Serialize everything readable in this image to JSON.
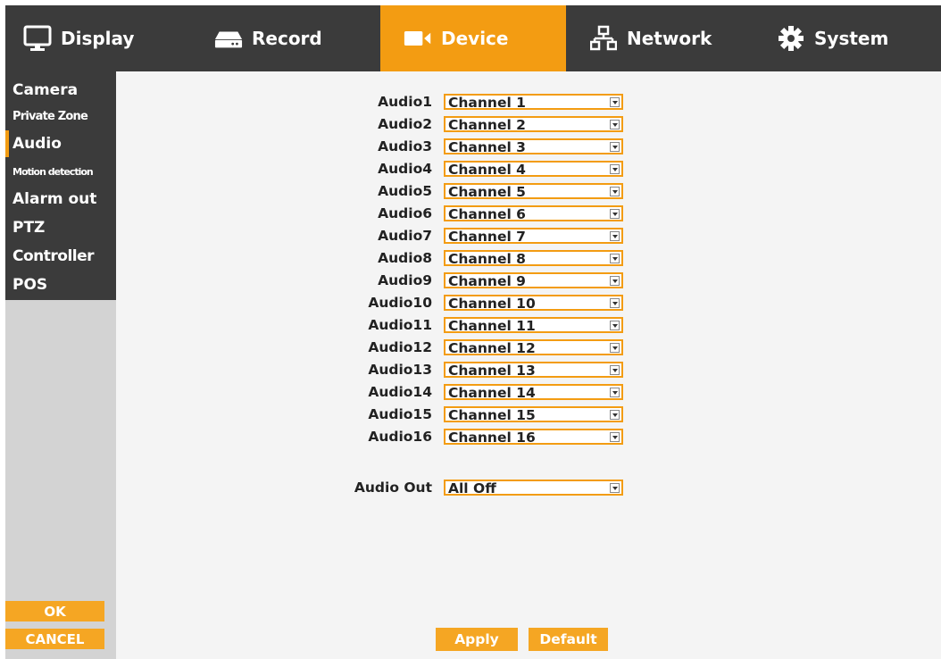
{
  "nav": {
    "tabs": [
      {
        "label": "Display"
      },
      {
        "label": "Record"
      },
      {
        "label": "Device"
      },
      {
        "label": "Network"
      },
      {
        "label": "System"
      }
    ],
    "active_tab": "Device"
  },
  "sidebar": {
    "items": [
      {
        "label": "Camera"
      },
      {
        "label": "Private Zone"
      },
      {
        "label": "Audio"
      },
      {
        "label": "Motion detection"
      },
      {
        "label": "Alarm out"
      },
      {
        "label": "PTZ"
      },
      {
        "label": "Controller"
      },
      {
        "label": "POS"
      }
    ],
    "active_item": "Audio",
    "ok_label": "OK",
    "cancel_label": "CANCEL"
  },
  "audio": {
    "rows": [
      {
        "label": "Audio1",
        "value": "Channel 1"
      },
      {
        "label": "Audio2",
        "value": "Channel 2"
      },
      {
        "label": "Audio3",
        "value": "Channel 3"
      },
      {
        "label": "Audio4",
        "value": "Channel 4"
      },
      {
        "label": "Audio5",
        "value": "Channel 5"
      },
      {
        "label": "Audio6",
        "value": "Channel 6"
      },
      {
        "label": "Audio7",
        "value": "Channel 7"
      },
      {
        "label": "Audio8",
        "value": "Channel 8"
      },
      {
        "label": "Audio9",
        "value": "Channel 9"
      },
      {
        "label": "Audio10",
        "value": "Channel 10"
      },
      {
        "label": "Audio11",
        "value": "Channel 11"
      },
      {
        "label": "Audio12",
        "value": "Channel 12"
      },
      {
        "label": "Audio13",
        "value": "Channel 13"
      },
      {
        "label": "Audio14",
        "value": "Channel 14"
      },
      {
        "label": "Audio15",
        "value": "Channel 15"
      },
      {
        "label": "Audio16",
        "value": "Channel 16"
      }
    ],
    "out": {
      "label": "Audio Out",
      "value": "All Off"
    }
  },
  "actions": {
    "apply_label": "Apply",
    "default_label": "Default"
  },
  "colors": {
    "accent": "#f39c12",
    "nav_bg": "#3b3b3b",
    "content_bg": "#f4f4f4"
  },
  "icons": {
    "display": "monitor-icon",
    "record": "dvr-icon",
    "device": "camera-icon",
    "network": "network-icon",
    "system": "gear-icon"
  }
}
